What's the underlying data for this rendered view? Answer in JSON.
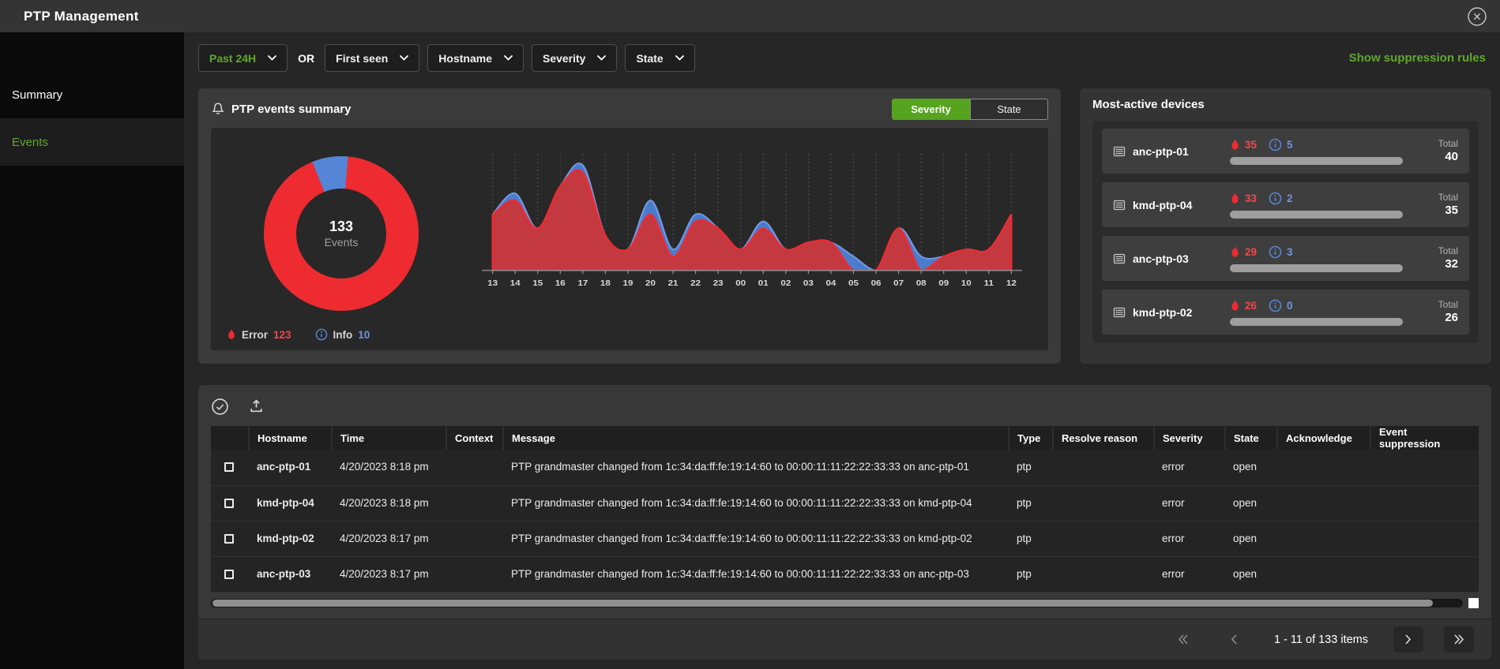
{
  "header": {
    "title": "PTP Management"
  },
  "sidebar": {
    "items": [
      {
        "label": "Summary",
        "active": false
      },
      {
        "label": "Events",
        "active": true
      }
    ]
  },
  "filters": {
    "time_range": "Past 24H",
    "or_label": "OR",
    "dropdowns": [
      "First seen",
      "Hostname",
      "Severity",
      "State"
    ],
    "suppression_link": "Show suppression rules"
  },
  "summary_card": {
    "title": "PTP events summary",
    "toggle": {
      "options": [
        "Severity",
        "State"
      ],
      "selected": "Severity"
    },
    "donut_center": {
      "value": "133",
      "label": "Events"
    },
    "legend": [
      {
        "label": "Error",
        "value": "123",
        "color": "#ee2b30",
        "icon": "flame-icon"
      },
      {
        "label": "Info",
        "value": "10",
        "color": "#5585d6",
        "icon": "info-icon"
      }
    ]
  },
  "devices_card": {
    "title": "Most-active devices",
    "total_label": "Total",
    "devices": [
      {
        "name": "anc-ptp-01",
        "errors": "35",
        "info": "5",
        "total": "40"
      },
      {
        "name": "kmd-ptp-04",
        "errors": "33",
        "info": "2",
        "total": "35"
      },
      {
        "name": "anc-ptp-03",
        "errors": "29",
        "info": "3",
        "total": "32"
      },
      {
        "name": "kmd-ptp-02",
        "errors": "26",
        "info": "0",
        "total": "26"
      }
    ]
  },
  "table": {
    "columns": [
      "",
      "Hostname",
      "Time",
      "Context",
      "Message",
      "Type",
      "Resolve reason",
      "Severity",
      "State",
      "Acknowledge",
      "Event suppression"
    ],
    "rows": [
      {
        "cells": [
          "anc-ptp-01",
          "4/20/2023 8:18 pm",
          "",
          "PTP grandmaster changed from 1c:34:da:ff:fe:19:14:60 to 00:00:11:11:22:22:33:33 on anc-ptp-01",
          "ptp",
          "",
          "error",
          "open",
          "",
          ""
        ]
      },
      {
        "cells": [
          "kmd-ptp-04",
          "4/20/2023 8:18 pm",
          "",
          "PTP grandmaster changed from 1c:34:da:ff:fe:19:14:60 to 00:00:11:11:22:22:33:33 on kmd-ptp-04",
          "ptp",
          "",
          "error",
          "open",
          "",
          ""
        ]
      },
      {
        "cells": [
          "kmd-ptp-02",
          "4/20/2023 8:17 pm",
          "",
          "PTP grandmaster changed from 1c:34:da:ff:fe:19:14:60 to 00:00:11:11:22:22:33:33 on kmd-ptp-02",
          "ptp",
          "",
          "error",
          "open",
          "",
          ""
        ]
      },
      {
        "cells": [
          "anc-ptp-03",
          "4/20/2023 8:17 pm",
          "",
          "PTP grandmaster changed from 1c:34:da:ff:fe:19:14:60 to 00:00:11:11:22:22:33:33 on anc-ptp-03",
          "ptp",
          "",
          "error",
          "open",
          "",
          ""
        ]
      }
    ],
    "pagination": {
      "range_text": "1 - 11 of 133 items"
    }
  },
  "chart_data": [
    {
      "type": "pie",
      "title": "PTP events by severity (last 24h)",
      "labels": [
        "Error",
        "Info"
      ],
      "values": [
        123,
        10
      ],
      "total": 133,
      "center_text": "133 Events",
      "colors": [
        "#ee2b30",
        "#5585d6"
      ]
    },
    {
      "type": "area",
      "stacked": true,
      "x": [
        "13",
        "14",
        "15",
        "16",
        "17",
        "18",
        "19",
        "20",
        "21",
        "22",
        "23",
        "00",
        "01",
        "02",
        "03",
        "04",
        "05",
        "06",
        "07",
        "08",
        "09",
        "10",
        "11",
        "12"
      ],
      "series": [
        {
          "name": "Error",
          "color": "#ee2b30",
          "values": [
            8,
            10,
            6,
            12,
            14,
            5,
            3,
            8,
            2,
            7,
            6,
            3,
            6,
            3,
            4,
            4,
            0,
            0,
            6,
            0,
            2,
            3,
            3,
            8
          ]
        },
        {
          "name": "Info",
          "color": "#5585d6",
          "values": [
            0,
            1,
            0,
            0,
            1,
            0,
            0,
            2,
            1,
            1,
            0,
            0,
            1,
            0,
            0,
            0,
            2,
            0,
            0,
            2,
            0,
            0,
            0,
            0
          ]
        }
      ],
      "ylim": [
        0,
        16
      ],
      "grid": "vertical-dashed",
      "legend_position": "bottom-left"
    }
  ],
  "colors": {
    "accent_green": "#5fa82c",
    "toggle_green": "#55a31e",
    "error_red": "#ee2b30",
    "info_blue": "#5585d6",
    "bar_gray": "#9e9e9e"
  }
}
